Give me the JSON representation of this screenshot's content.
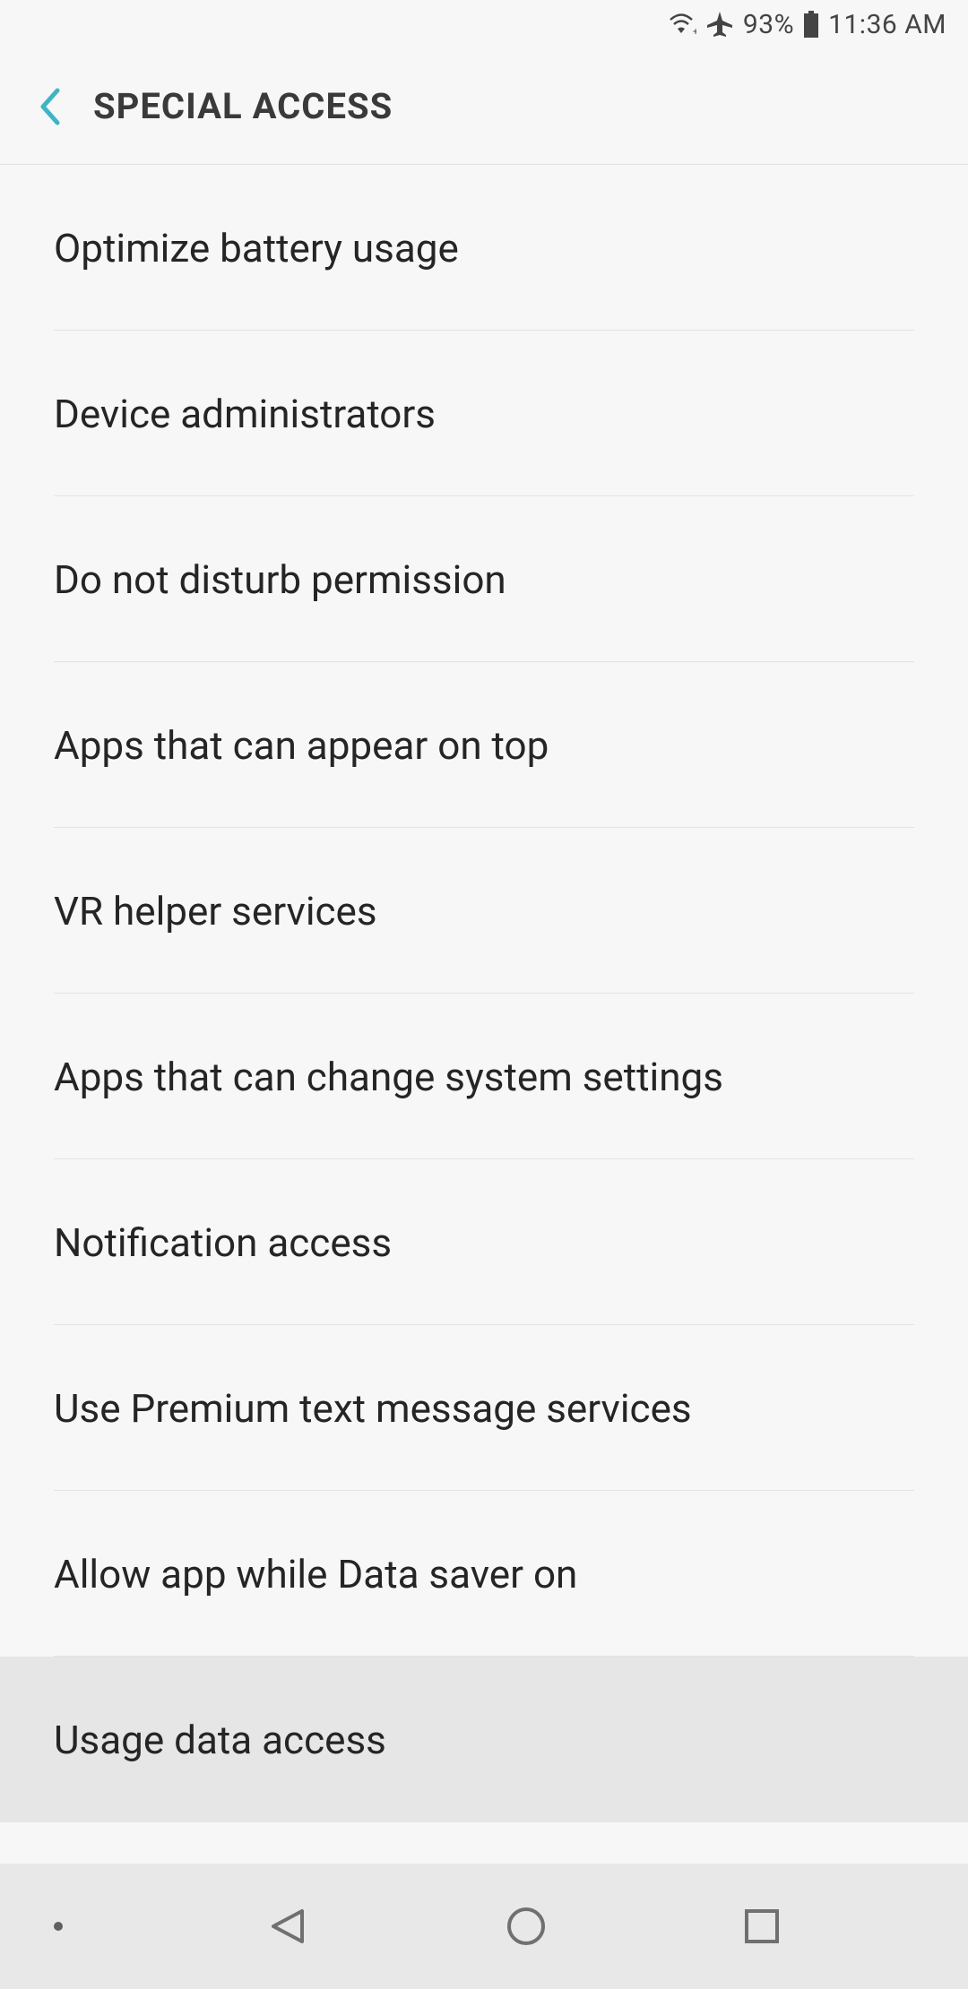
{
  "status": {
    "battery_pct": "93%",
    "time": "11:36 AM"
  },
  "header": {
    "title": "SPECIAL ACCESS"
  },
  "items": [
    {
      "label": "Optimize battery usage",
      "selected": false
    },
    {
      "label": "Device administrators",
      "selected": false
    },
    {
      "label": "Do not disturb permission",
      "selected": false
    },
    {
      "label": "Apps that can appear on top",
      "selected": false
    },
    {
      "label": "VR helper services",
      "selected": false
    },
    {
      "label": "Apps that can change system settings",
      "selected": false
    },
    {
      "label": "Notification access",
      "selected": false
    },
    {
      "label": "Use Premium text message services",
      "selected": false
    },
    {
      "label": "Allow app while Data saver on",
      "selected": false
    },
    {
      "label": "Usage data access",
      "selected": true
    }
  ]
}
